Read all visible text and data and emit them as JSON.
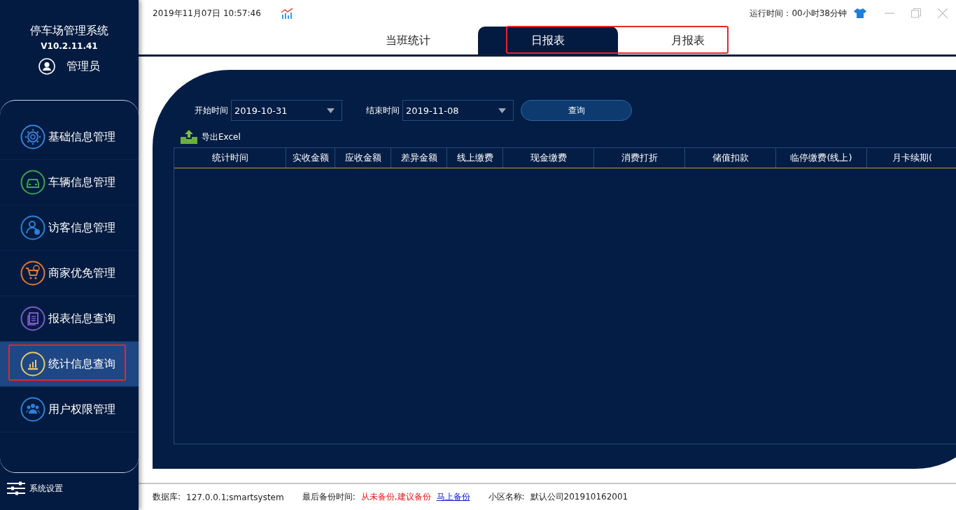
{
  "app": {
    "title": "停车场管理系统",
    "version": "V10.2.11.41",
    "user": "管理员"
  },
  "nav_items": [
    {
      "label": "基础信息管理",
      "kind": "gear",
      "selected": false,
      "highlighted": false
    },
    {
      "label": "车辆信息管理",
      "kind": "car",
      "selected": false,
      "highlighted": false
    },
    {
      "label": "访客信息管理",
      "kind": "visitor",
      "selected": false,
      "highlighted": false
    },
    {
      "label": "商家优免管理",
      "kind": "cart",
      "selected": false,
      "highlighted": false
    },
    {
      "label": "报表信息查询",
      "kind": "report",
      "selected": false,
      "highlighted": false
    },
    {
      "label": "统计信息查询",
      "kind": "chart",
      "selected": true,
      "highlighted": true
    },
    {
      "label": "用户权限管理",
      "kind": "users",
      "selected": false,
      "highlighted": false
    }
  ],
  "settings": {
    "label": "系统设置"
  },
  "top_bar": {
    "datetime": "2019年11月07日 10:57:46",
    "runtime": "运行时间：00小时38分钟"
  },
  "tabs": [
    {
      "label": "当班统计",
      "selected": false,
      "highlighted": false
    },
    {
      "label": "日报表",
      "selected": true,
      "highlighted": true
    },
    {
      "label": "月报表",
      "selected": false,
      "highlighted": true
    }
  ],
  "filters": {
    "start_label": "开始时间",
    "start_value": "2019-10-31",
    "end_label": "结束时间",
    "end_value": "2019-11-08",
    "query_button": "查询",
    "export_button": "导出Excel"
  },
  "table": {
    "columns": [
      "统计时间",
      "实收金额",
      "应收金额",
      "差异金额",
      "线上缴费",
      "现金缴费",
      "消费打折",
      "储值扣款",
      "临停缴费(线上)",
      "月卡续期("
    ]
  },
  "status_bar": {
    "database_label": "数据库:",
    "database_value": "127.0.0.1;smartsystem",
    "backup_label": "最后备份时间:",
    "backup_value": "从未备份,建议备份",
    "backup_link": "马上备份",
    "community_label": "小区名称:",
    "community_value": "默认公司201910162001"
  }
}
